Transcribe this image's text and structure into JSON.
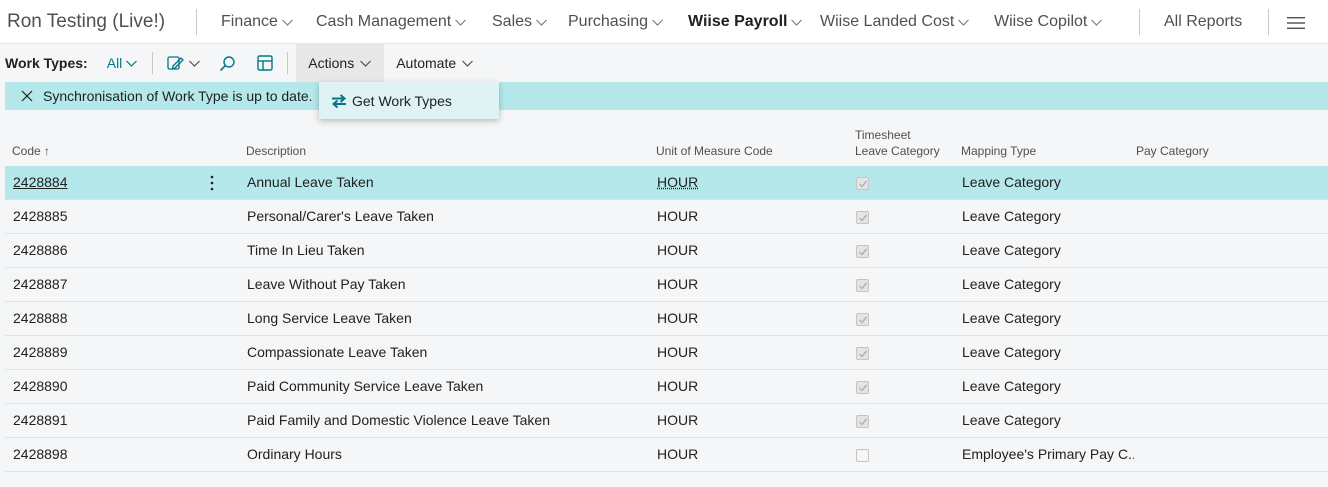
{
  "company": "Ron Testing (Live!)",
  "nav": [
    {
      "label": "Finance",
      "active": false
    },
    {
      "label": "Cash Management",
      "active": false
    },
    {
      "label": "Sales",
      "active": false
    },
    {
      "label": "Purchasing",
      "active": false
    },
    {
      "label": "Wiise Payroll",
      "active": true
    },
    {
      "label": "Wiise Landed Cost",
      "active": false
    },
    {
      "label": "Wiise Copilot",
      "active": false
    }
  ],
  "all_reports": "All Reports",
  "toolbar": {
    "filter_label": "Work Types:",
    "filter_value": "All",
    "actions_label": "Actions",
    "automate_label": "Automate"
  },
  "notification": "Synchronisation of Work Type is up to date.",
  "dropdown": {
    "item": "Get Work Types"
  },
  "columns": {
    "code": "Code",
    "description": "Description",
    "uom": "Unit of Measure Code",
    "timesheet_line1": "Timesheet",
    "timesheet_line2": "Leave Category",
    "mapping": "Mapping Type",
    "pay_category": "Pay Category"
  },
  "rows": [
    {
      "code": "2428884",
      "description": "Annual Leave Taken",
      "uom": "HOUR",
      "checked": true,
      "mapping": "Leave Category"
    },
    {
      "code": "2428885",
      "description": "Personal/Carer's Leave Taken",
      "uom": "HOUR",
      "checked": true,
      "mapping": "Leave Category"
    },
    {
      "code": "2428886",
      "description": "Time In Lieu Taken",
      "uom": "HOUR",
      "checked": true,
      "mapping": "Leave Category"
    },
    {
      "code": "2428887",
      "description": "Leave Without Pay Taken",
      "uom": "HOUR",
      "checked": true,
      "mapping": "Leave Category"
    },
    {
      "code": "2428888",
      "description": "Long Service Leave Taken",
      "uom": "HOUR",
      "checked": true,
      "mapping": "Leave Category"
    },
    {
      "code": "2428889",
      "description": "Compassionate Leave Taken",
      "uom": "HOUR",
      "checked": true,
      "mapping": "Leave Category"
    },
    {
      "code": "2428890",
      "description": "Paid Community Service Leave Taken",
      "uom": "HOUR",
      "checked": true,
      "mapping": "Leave Category"
    },
    {
      "code": "2428891",
      "description": "Paid Family and Domestic Violence Leave Taken",
      "uom": "HOUR",
      "checked": true,
      "mapping": "Leave Category"
    },
    {
      "code": "2428898",
      "description": "Ordinary Hours",
      "uom": "HOUR",
      "checked": false,
      "mapping": "Employee's Primary Pay C..."
    }
  ],
  "colors": {
    "accent": "#00788a",
    "highlight": "#b4e8eb"
  }
}
